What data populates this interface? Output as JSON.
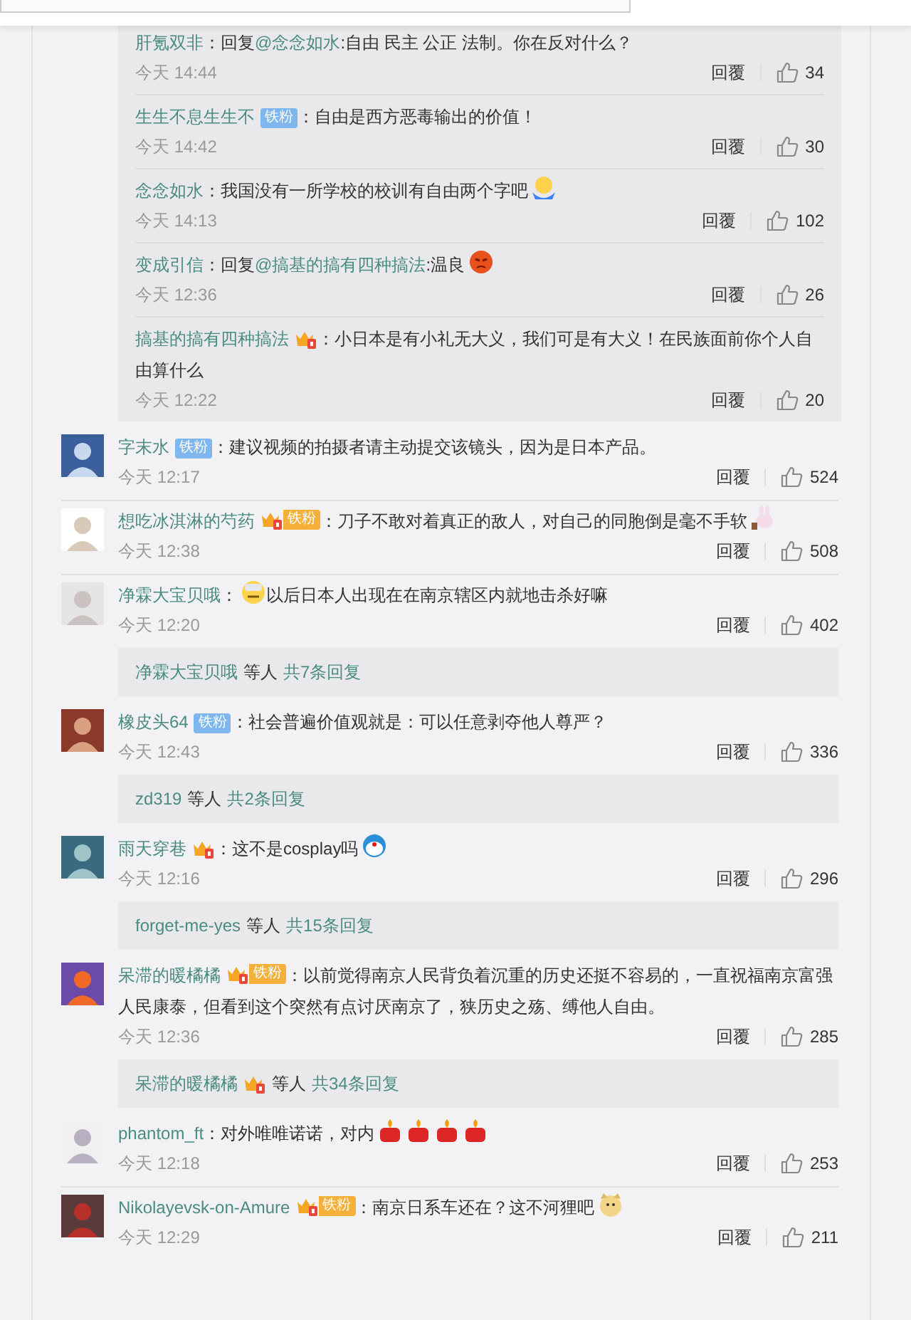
{
  "sub_replies": [
    {
      "name": "肝氪双非",
      "content": [
        {
          "kind": "text",
          "text": "：回复"
        },
        {
          "kind": "mention",
          "text": "@念念如水"
        },
        {
          "kind": "text",
          "text": ":自由 民主 公正 法制。你在反对什么？"
        }
      ],
      "time": "今天 14:44",
      "reply": "回覆",
      "likes": "34"
    },
    {
      "name": "生生不息生生不",
      "badges": [
        {
          "kind": "fan",
          "label": "铁粉"
        }
      ],
      "content": [
        {
          "kind": "text",
          "text": "：自由是西方恶毒输出的价值！"
        }
      ],
      "time": "今天 14:42",
      "reply": "回覆",
      "likes": "30"
    },
    {
      "name": "念念如水",
      "content": [
        {
          "kind": "text",
          "text": "：我国没有一所学校的校训有自由两个字吧"
        },
        {
          "kind": "shrug"
        }
      ],
      "time": "今天 14:13",
      "reply": "回覆",
      "likes": "102"
    },
    {
      "name": "变成引信",
      "content": [
        {
          "kind": "text",
          "text": "：回复"
        },
        {
          "kind": "mention",
          "text": "@搞基的搞有四种搞法"
        },
        {
          "kind": "text",
          "text": ":温良"
        },
        {
          "kind": "angry"
        }
      ],
      "time": "今天 12:36",
      "reply": "回覆",
      "likes": "26"
    },
    {
      "name": "搞基的搞有四种搞法",
      "badges": [
        {
          "kind": "crown"
        }
      ],
      "content": [
        {
          "kind": "text",
          "text": "：小日本是有小礼无大义，我们可是有大义！在民族面前你个人自由算什么"
        }
      ],
      "time": "今天 12:22",
      "reply": "回覆",
      "likes": "20"
    }
  ],
  "comments": [
    {
      "name": "字末水",
      "badges": [
        {
          "kind": "fan",
          "label": "铁粉"
        }
      ],
      "content": [
        {
          "kind": "text",
          "text": "：建议视频的拍摄者请主动提交该镜头，因为是日本产品。"
        }
      ],
      "time": "今天 12:17",
      "reply": "回覆",
      "likes": "524"
    },
    {
      "name": "想吃冰淇淋的芍药",
      "badges": [
        {
          "kind": "crown_fan",
          "label": "铁粉"
        }
      ],
      "content": [
        {
          "kind": "text",
          "text": "：刀子不敢对着真正的敌人，对自己的同胞倒是毫不手软"
        },
        {
          "kind": "rabbit"
        }
      ],
      "time": "今天 12:38",
      "reply": "回覆",
      "likes": "508"
    },
    {
      "name": "净霖大宝贝哦",
      "content": [
        {
          "kind": "text",
          "text": "："
        },
        {
          "kind": "mask"
        },
        {
          "kind": "text",
          "text": "以后日本人出现在在南京辖区内就地击杀好嘛"
        }
      ],
      "time": "今天 12:20",
      "reply": "回覆",
      "likes": "402",
      "more": {
        "names": "净霖大宝贝哦",
        "badge": false,
        "others": "等人",
        "count": "共7条回复"
      }
    },
    {
      "name": "橡皮头64",
      "badges": [
        {
          "kind": "fan",
          "label": "铁粉"
        }
      ],
      "content": [
        {
          "kind": "text",
          "text": "：社会普遍价值观就是：可以任意剥夺他人尊严？"
        }
      ],
      "time": "今天 12:43",
      "reply": "回覆",
      "likes": "336",
      "more": {
        "names": "zd319",
        "badge": false,
        "others": "等人",
        "count": "共2条回复"
      }
    },
    {
      "name": "雨天穿巷",
      "badges": [
        {
          "kind": "crown"
        }
      ],
      "content": [
        {
          "kind": "text",
          "text": "：这不是cosplay吗"
        },
        {
          "kind": "doraemon"
        }
      ],
      "time": "今天 12:16",
      "reply": "回覆",
      "likes": "296",
      "more": {
        "names": "forget-me-yes",
        "badge": false,
        "others": "等人",
        "count": "共15条回复"
      }
    },
    {
      "name": "呆滞的暖橘橘",
      "badges": [
        {
          "kind": "crown_fan",
          "label": "铁粉"
        }
      ],
      "content": [
        {
          "kind": "text",
          "text": "：以前觉得南京人民背负着沉重的历史还挺不容易的，一直祝福南京富强人民康泰，但看到这个突然有点讨厌南京了，狭历史之殇、缚他人自由。"
        }
      ],
      "time": "今天 12:36",
      "reply": "回覆",
      "likes": "285",
      "more": {
        "names": "呆滞的暖橘橘",
        "badge": true,
        "others": "等人",
        "count": "共34条回复"
      }
    },
    {
      "name": "phantom_ft",
      "content": [
        {
          "kind": "text",
          "text": "：对外唯唯诺诺，对内"
        },
        {
          "kind": "candle"
        },
        {
          "kind": "candle"
        },
        {
          "kind": "candle"
        },
        {
          "kind": "candle"
        }
      ],
      "time": "今天 12:18",
      "reply": "回覆",
      "likes": "253"
    },
    {
      "name": "Nikolayevsk-on-Amure",
      "badges": [
        {
          "kind": "crown_fan",
          "label": "铁粉"
        }
      ],
      "content": [
        {
          "kind": "text",
          "text": "：南京日系车还在？这不河狸吧"
        },
        {
          "kind": "doge"
        }
      ],
      "time": "今天 12:29",
      "reply": "回覆",
      "likes": "211"
    }
  ]
}
